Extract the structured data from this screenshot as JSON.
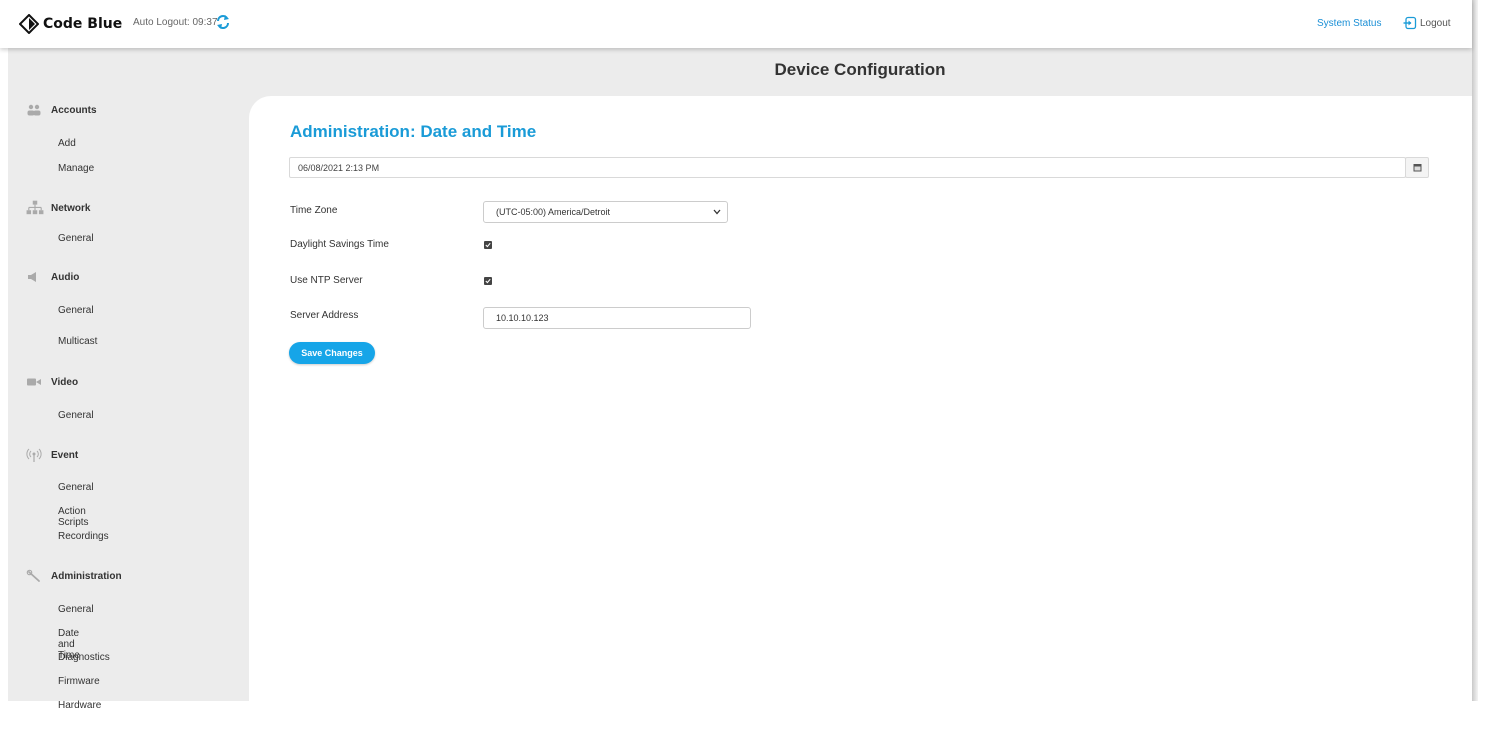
{
  "topbar": {
    "brand": "Code Blue",
    "auto_logout": "Auto Logout: 09:37",
    "system_status": "System Status",
    "logout": "Logout"
  },
  "header": {
    "title": "Device Configuration"
  },
  "sidebar": {
    "sections": [
      {
        "label": "Accounts",
        "icon": "users-icon",
        "items": [
          "Add",
          "Manage"
        ]
      },
      {
        "label": "Network",
        "icon": "network-icon",
        "items": [
          "General"
        ]
      },
      {
        "label": "Audio",
        "icon": "speaker-icon",
        "items": [
          "General",
          "Multicast"
        ]
      },
      {
        "label": "Video",
        "icon": "video-camera-icon",
        "items": [
          "General"
        ]
      },
      {
        "label": "Event",
        "icon": "broadcast-icon",
        "items": [
          "General",
          "Action Scripts",
          "Recordings"
        ]
      },
      {
        "label": "Administration",
        "icon": "wrench-icon",
        "items": [
          "General",
          "Date and Time",
          "Diagnostics",
          "Firmware",
          "Hardware"
        ]
      }
    ]
  },
  "main": {
    "title": "Administration: Date and Time",
    "datetime_value": "06/08/2021 2:13 PM",
    "time_zone_label": "Time Zone",
    "time_zone_value": "(UTC-05:00) America/Detroit",
    "dst_label": "Daylight Savings Time",
    "dst_checked": true,
    "ntp_label": "Use NTP Server",
    "ntp_checked": true,
    "server_address_label": "Server Address",
    "server_address_value": "10.10.10.123",
    "save_label": "Save Changes"
  },
  "colors": {
    "accent": "#1a9bd7",
    "button": "#16a5e8",
    "frame": "#ececec"
  }
}
